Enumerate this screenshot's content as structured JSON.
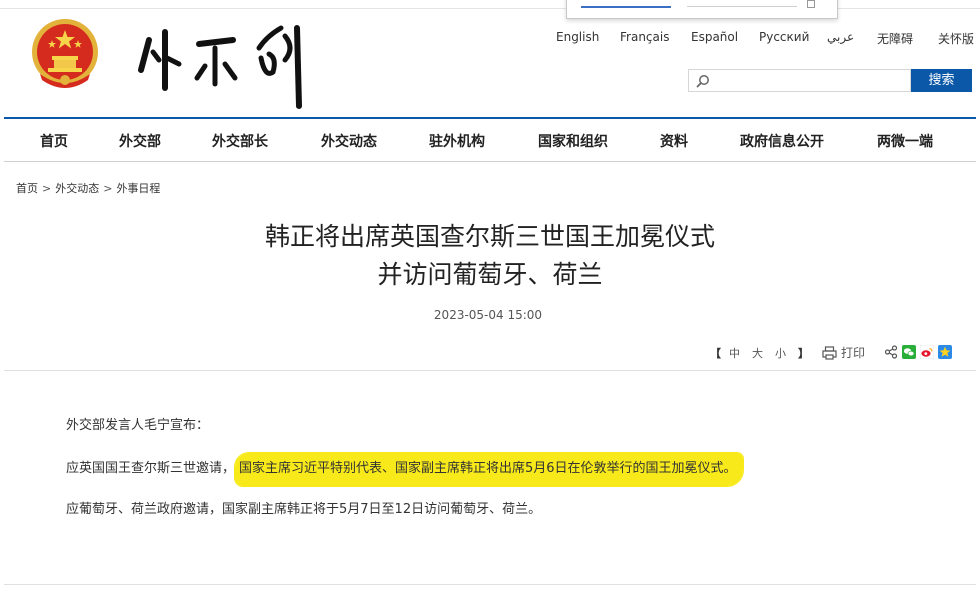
{
  "header": {
    "emblem_icon": "national-emblem-icon",
    "logo_icon": "mfa-calligraphy-logo-icon",
    "languages": [
      "English",
      "Français",
      "Español",
      "Русский",
      "عربي",
      "无障碍",
      "关怀版"
    ],
    "search": {
      "placeholder": "",
      "button_label": "搜索"
    }
  },
  "nav": {
    "items": [
      "首页",
      "外交部",
      "外交部长",
      "外交动态",
      "驻外机构",
      "国家和组织",
      "资料",
      "政府信息公开",
      "两微一端"
    ]
  },
  "breadcrumb": [
    "首页",
    "外交动态",
    "外事日程"
  ],
  "breadcrumb_sep": ">",
  "article": {
    "title_line1": "韩正将出席英国查尔斯三世国王加冕仪式",
    "title_line2": "并访问葡萄牙、荷兰",
    "date": "2023-05-04 15:00",
    "paragraphs": {
      "p1": "外交部发言人毛宁宣布：",
      "p2_plain": "应英国国王查尔斯三世邀请，",
      "p2_highlight": "国家主席习近平特别代表、国家副主席韩正将出席5月6日在伦敦举行的国王加冕仪式。",
      "p3": "应葡萄牙、荷兰政府邀请，国家副主席韩正将于5月7日至12日访问葡萄牙、荷兰。"
    }
  },
  "tools": {
    "bracket_open": "【",
    "bracket_close": "】",
    "font_sizes": [
      "中",
      "大",
      "小"
    ],
    "print_label": "打印",
    "share_icons": [
      "share-icon",
      "wechat-icon",
      "weibo-icon",
      "qzone-icon"
    ]
  },
  "colors": {
    "brand_blue": "#0b58a8",
    "highlight_yellow": "#f8ea1a"
  }
}
